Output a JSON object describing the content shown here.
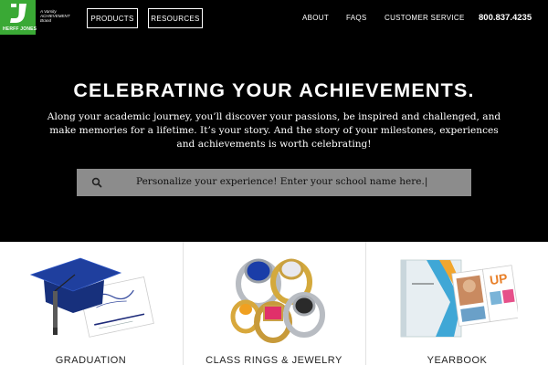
{
  "header": {
    "logo_text": "HERFF JONES",
    "brand_line": "A Varsity ACHIEVEMENT Brand",
    "nav_buttons": [
      "PRODUCTS",
      "RESOURCES"
    ],
    "nav_links": [
      "ABOUT",
      "FAQS",
      "CUSTOMER SERVICE"
    ],
    "phone": "800.837.4235",
    "brand_color": "#3aa935"
  },
  "hero": {
    "title": "CELEBRATING YOUR ACHIEVEMENTS.",
    "copy": "Along your academic journey, you’ll discover your passions, be inspired and challenged, and make memories for a lifetime. It’s your story. And the story of your milestones, experiences and achievements is worth celebrating!",
    "search": {
      "value": "Personalize your experience! Enter your school name here.|",
      "icon": "search-icon"
    }
  },
  "products": [
    {
      "label": "GRADUATION",
      "image": "graduation-cap-and-announcement"
    },
    {
      "label": "CLASS RINGS & JEWELRY",
      "image": "class-rings"
    },
    {
      "label": "YEARBOOK",
      "image": "yearbooks"
    }
  ]
}
